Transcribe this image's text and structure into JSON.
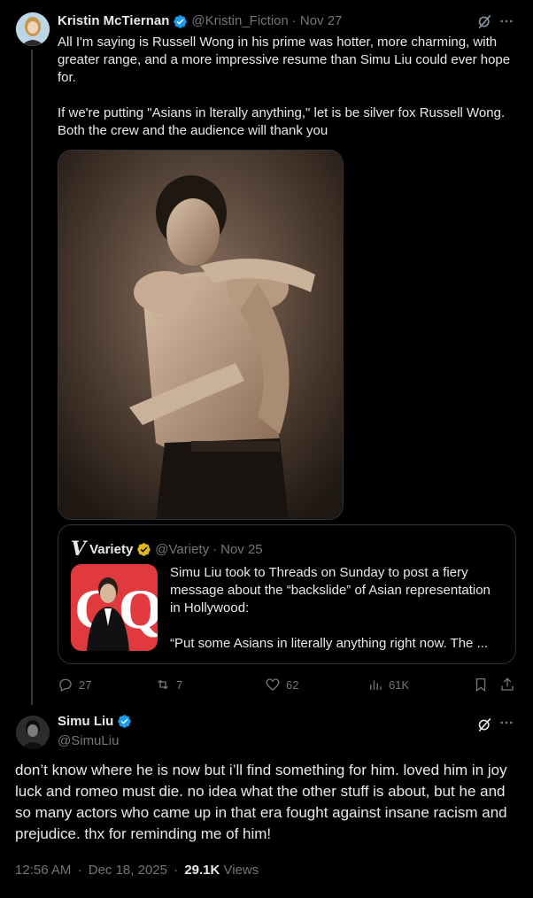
{
  "tweet1": {
    "author_name": "Kristin McTiernan",
    "handle": "@Kristin_Fiction",
    "date": "Nov 27",
    "separator": "·",
    "paragraphs": [
      "All I'm saying is Russell Wong in his prime was hotter, more charming, with greater range, and a more impressive resume than Simu Liu could ever hope for.",
      "If we're putting \"Asians in lterally anything,\" let is be silver fox Russell Wong. Both the crew and the audience will thank you"
    ],
    "quote": {
      "logo_letter": "V",
      "author_name": "Variety",
      "handle": "@Variety",
      "date": "Nov 25",
      "separator": "·",
      "text_line1": "Simu Liu took to Threads on Sunday to post a fiery message about the “backslide” of Asian representation in Hollywood:",
      "text_line2": "“Put some Asians in literally anything right now. The ...",
      "thumb_letters": "GQ"
    },
    "actions": {
      "replies": "27",
      "reposts": "7",
      "likes": "62",
      "views": "61K"
    }
  },
  "tweet2": {
    "author_name": "Simu Liu",
    "handle": "@SimuLiu",
    "text": "don’t know where he is now but i’ll find something for him. loved him in joy luck and romeo must die. no idea what the other stuff is about, but he and so many actors who came up in that era fought against insane racism and prejudice. thx for reminding me of him!",
    "time": "12:56 AM",
    "date": "Dec 18, 2025",
    "separator": "·",
    "views_count": "29.1K",
    "views_label": "Views"
  },
  "colors": {
    "background": "#000000",
    "text": "#e7e9ea",
    "muted": "#71767b",
    "verified_blue": "#1d9bf0",
    "verified_gold": "#e2b719",
    "border": "#2f3336"
  },
  "icons": [
    "grok-icon",
    "more-icon",
    "reply-icon",
    "repost-icon",
    "like-icon",
    "views-icon",
    "bookmark-icon",
    "share-icon",
    "verified-badge-icon"
  ]
}
